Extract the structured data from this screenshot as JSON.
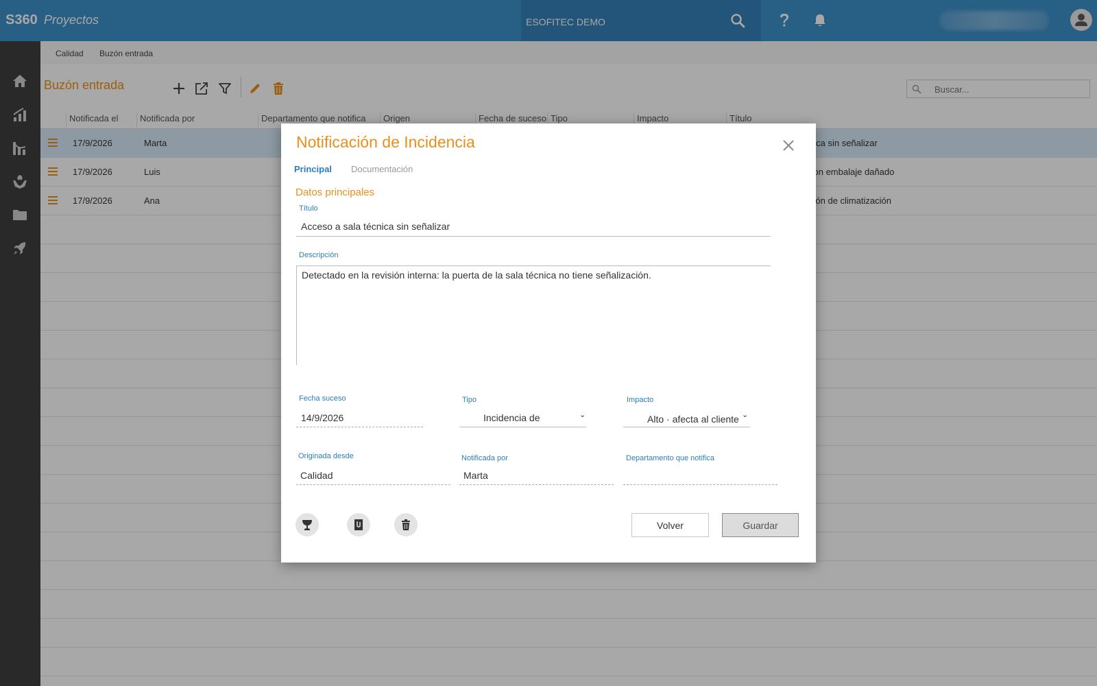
{
  "header": {
    "brand": "S360",
    "app_name": "Proyectos",
    "company": "ESOFITEC DEMO"
  },
  "breadcrumb": [
    "Calidad",
    "Buzón entrada"
  ],
  "page": {
    "title": "Buzón entrada",
    "search_placeholder": "Buscar..."
  },
  "grid": {
    "columns": [
      "Notificada el",
      "Notificada por",
      "Departamento que notifica",
      "Origen",
      "Fecha de suceso",
      "Tipo",
      "Impacto",
      "Título"
    ],
    "rows": [
      {
        "date": "17/9/2026",
        "by": "Marta",
        "title_tail": "nica sin señalizar"
      },
      {
        "date": "17/9/2026",
        "by": "Luis",
        "title_tail": "con embalaje dañado"
      },
      {
        "date": "17/9/2026",
        "by": "Ana",
        "title_tail": "sión de climatización"
      }
    ]
  },
  "modal": {
    "title": "Notificación de Incidencia",
    "tabs": [
      "Principal",
      "Documentación"
    ],
    "section": "Datos principales",
    "fields": {
      "titulo_label": "Título",
      "titulo_value": "Acceso a sala técnica sin señalizar",
      "descripcion_label": "Descripción",
      "descripcion_value": "Detectado en la revisión interna: la puerta de la sala técnica no tiene señalización.",
      "fecha_label": "Fecha suceso",
      "fecha_value": "14/9/2026",
      "tipo_label": "Tipo",
      "tipo_value": "Incidencia de",
      "impacto_label": "Impacto",
      "impacto_value": "Alto · afecta al cliente",
      "originada_label": "Originada desde",
      "originada_value": "Calidad",
      "notificada_label": "Notificada por",
      "notificada_value": "Marta",
      "departamento_label": "Departamento que notifica",
      "departamento_value": ""
    },
    "buttons": {
      "volver": "Volver",
      "guardar": "Guardar"
    }
  },
  "colors": {
    "topbar": "#3d90c9",
    "sidebar": "#3f3f3f",
    "accent": "#e8901b",
    "link": "#2a7fba"
  }
}
